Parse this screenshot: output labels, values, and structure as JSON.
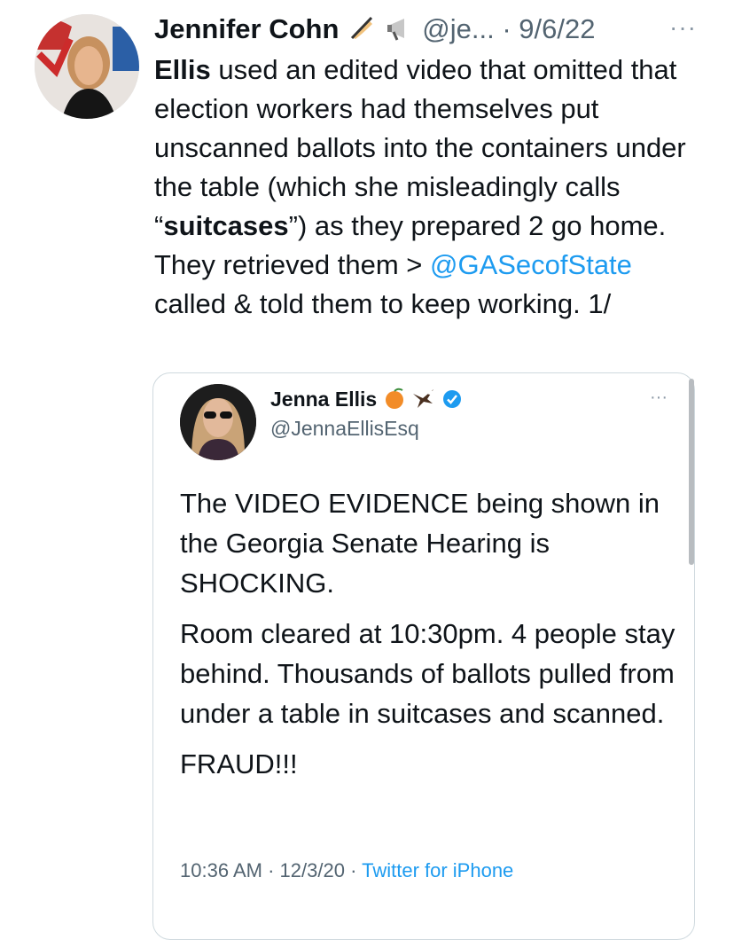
{
  "tweet": {
    "author_name": "Jennifer Cohn",
    "emoji_1": "writing-hand-icon",
    "emoji_2": "megaphone-icon",
    "handle": "@je...",
    "separator": "·",
    "date": "9/6/22",
    "more": "···",
    "text": {
      "part1": "Ellis",
      "part2": " used an edited video that omitted that election workers had themselves put unscanned ballots into the containers under the table (which she misleadingly calls “",
      "part3": "suitcases",
      "part4": "”) as they prepared 2 go home. They retrieved them > ",
      "mention": "@GASecofState",
      "part5": " called & told them to keep working. 1/"
    }
  },
  "quoted_tweet": {
    "author_name": "Jenna Ellis",
    "emoji_1": "peach-icon",
    "emoji_2": "eagle-icon",
    "verified": "verified-badge-icon",
    "handle": "@JennaEllisEsq",
    "more": "···",
    "paragraphs": [
      "The VIDEO EVIDENCE being shown in the Georgia Senate Hearing is SHOCKING.",
      "Room cleared at 10:30pm. 4 people stay behind. Thousands of ballots pulled from under a table in suitcases and scanned.",
      "FRAUD!!!"
    ],
    "time": "10:36 AM",
    "separator1": "·",
    "date": "12/3/20",
    "separator2": "·",
    "source": "Twitter for iPhone"
  },
  "colors": {
    "link": "#1d9bf0",
    "secondary_text": "#536471",
    "border": "#cfd9de"
  }
}
